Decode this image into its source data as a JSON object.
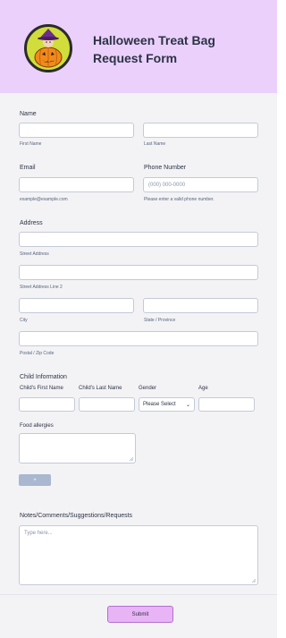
{
  "header": {
    "title": "Halloween Treat Bag Request Form"
  },
  "name": {
    "label": "Name",
    "first_sub": "First Name",
    "last_sub": "Last Name"
  },
  "email": {
    "label": "Email",
    "sub": "example@example.com"
  },
  "phone": {
    "label": "Phone Number",
    "placeholder": "(000) 000-0000",
    "sub": "Please enter a valid phone number."
  },
  "address": {
    "label": "Address",
    "street_sub": "Street Address",
    "street2_sub": "Street Address Line 2",
    "city_sub": "City",
    "state_sub": "State / Province",
    "postal_sub": "Postal / Zip Code"
  },
  "child": {
    "label": "Child Information",
    "columns": [
      "Child's First Name",
      "Child's Last Name",
      "Gender",
      "Age"
    ],
    "gender_value": "Please Select"
  },
  "allergies": {
    "label": "Food allergies"
  },
  "add_button": {
    "label": "+"
  },
  "notes": {
    "label": "Notes/Comments/Suggestions/Requests",
    "placeholder": "Type here..."
  },
  "submit": {
    "label": "Submit"
  },
  "colors": {
    "header_bg": "#ead0fb",
    "submit_bg": "#e8b4f5",
    "form_bg": "#f3f3f5"
  },
  "icons": {
    "logo": "witch-pumpkin-logo",
    "dropdown": "chevron-down-icon",
    "resize": "resize-handle-icon"
  }
}
